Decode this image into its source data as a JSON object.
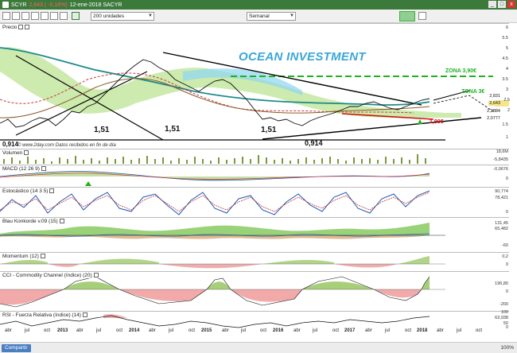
{
  "window": {
    "title": "SCYR",
    "change": "2,643 ( -0,16%)",
    "date_title": "12-ene-2018  SACYR",
    "minimize": "_",
    "maximize": "□",
    "close": "x"
  },
  "toolbar": {
    "units": "200 unidades",
    "period": "Semanal"
  },
  "price_panel": {
    "title": "Precio",
    "brand": "OCEAN INVESTMENT",
    "zona_top": "ZONA 3,90€",
    "zona_mid": "ZONA 3€",
    "price_tag": "1,90€",
    "level_left": "1,51",
    "level_mid": "1,51",
    "level_right": "1,51",
    "level_low": "0,914",
    "low_left": "0,914",
    "last_price": "2,643",
    "tag_2": "2,2884",
    "tag_3": "2,0777",
    "tag_4": "2,831",
    "axis": [
      "6",
      "5.5",
      "5",
      "4.5",
      "4",
      "3.5",
      "3",
      "2.5",
      "2",
      "1.5",
      "1"
    ],
    "footnote": "© www.2day.com  Datos recibidos en fin de día"
  },
  "panels": [
    {
      "title": "Volumen",
      "values": [
        "18,6M",
        "-5,8435"
      ]
    },
    {
      "title": "MACD (12 26 9)",
      "values": [
        "-0,0676",
        "0"
      ]
    },
    {
      "title": "Estocástico (14 3 5)",
      "values": [
        "90,774",
        "78,421",
        "0"
      ]
    },
    {
      "title": "Blau Konkorde v.09 (15)",
      "values": [
        "131,45",
        "65,482",
        "-60"
      ]
    },
    {
      "title": "Momentum (12)",
      "values": [
        "0,2",
        "0"
      ]
    },
    {
      "title": "CCI - Commodity Channel (índice) (20)",
      "values": [
        "196,80",
        "0",
        "-200"
      ]
    },
    {
      "title": "RSI - Fuerza Relativa (índice) (14)",
      "values": [
        "100",
        "63,938",
        "50",
        "0"
      ]
    }
  ],
  "x_axis": [
    {
      "label": "abr",
      "year": false
    },
    {
      "label": "jul",
      "year": false
    },
    {
      "label": "oct",
      "year": false
    },
    {
      "label": "2013",
      "year": true
    },
    {
      "label": "abr",
      "year": false
    },
    {
      "label": "jul",
      "year": false
    },
    {
      "label": "oct",
      "year": false
    },
    {
      "label": "2014",
      "year": true
    },
    {
      "label": "abr",
      "year": false
    },
    {
      "label": "jul",
      "year": false
    },
    {
      "label": "oct",
      "year": false
    },
    {
      "label": "2015",
      "year": true
    },
    {
      "label": "abr",
      "year": false
    },
    {
      "label": "jul",
      "year": false
    },
    {
      "label": "oct",
      "year": false
    },
    {
      "label": "2016",
      "year": true
    },
    {
      "label": "abr",
      "year": false
    },
    {
      "label": "jul",
      "year": false
    },
    {
      "label": "oct",
      "year": false
    },
    {
      "label": "2017",
      "year": true
    },
    {
      "label": "abr",
      "year": false
    },
    {
      "label": "jul",
      "year": false
    },
    {
      "label": "oct",
      "year": false
    },
    {
      "label": "2018",
      "year": true
    },
    {
      "label": "abr",
      "year": false
    },
    {
      "label": "jul",
      "year": false
    },
    {
      "label": "oct",
      "year": false
    }
  ],
  "status": {
    "share": "Compartir",
    "zoom": "100%"
  },
  "colors": {
    "titlebar": "#3c7a3c",
    "ocean": "#3aa6d8",
    "zona": "#1db31d",
    "red": "#d01010",
    "ichimoku": "#b8e28c",
    "ma_teal": "#1e8a8a"
  }
}
